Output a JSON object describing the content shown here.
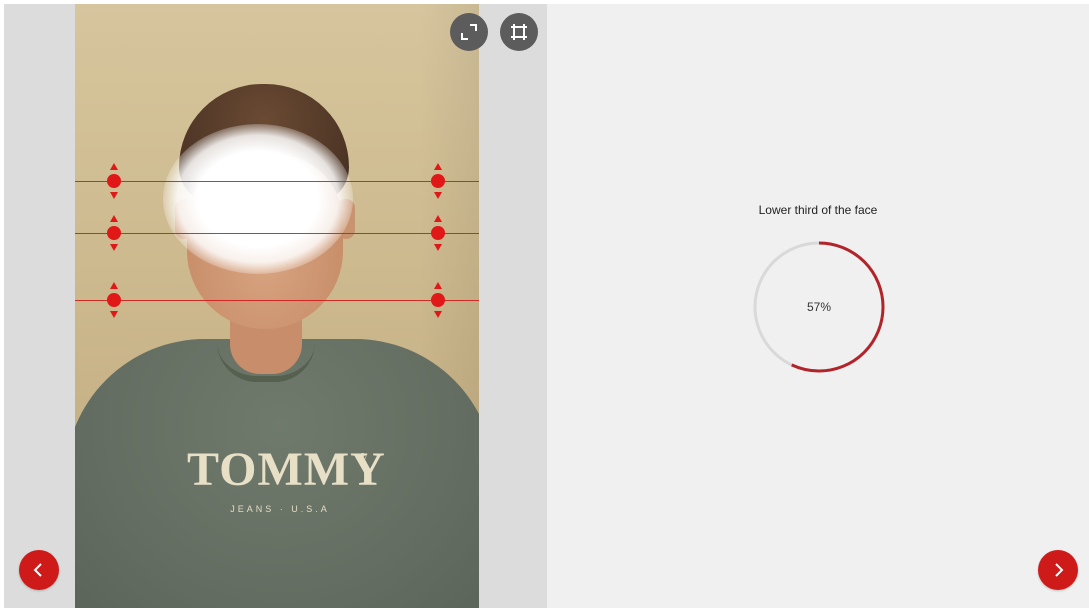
{
  "photo": {
    "shirt_brand": "TOMMY",
    "shirt_registered": "®",
    "shirt_subtext": "JEANS · U.S.A"
  },
  "toolbar": {
    "expand_icon": "expand-icon",
    "crop_icon": "crop-icon"
  },
  "analysis": {
    "title": "Lower third of the face",
    "value_label": "57%",
    "value_fraction": 0.57,
    "accent_color": "#b3242a",
    "track_color": "#d9d9d9"
  },
  "navigation": {
    "prev_icon": "chevron-left-icon",
    "next_icon": "chevron-right-icon",
    "button_color": "#cf1a1a"
  }
}
